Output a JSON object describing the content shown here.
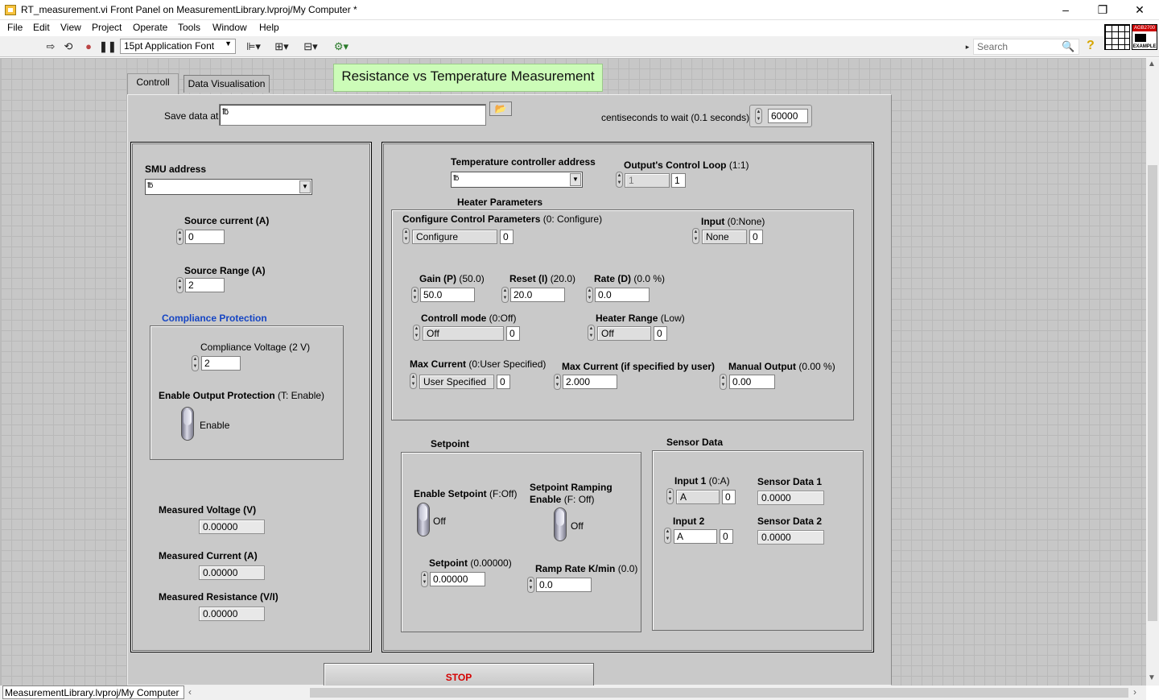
{
  "window": {
    "title": "RT_measurement.vi Front Panel on MeasurementLibrary.lvproj/My Computer *",
    "controls": [
      "–",
      "❐",
      "✕"
    ]
  },
  "menu": [
    "File",
    "Edit",
    "View",
    "Project",
    "Operate",
    "Tools",
    "Window",
    "Help"
  ],
  "toolbar": {
    "font": "15pt Application Font",
    "search_placeholder": "Search",
    "help": "?",
    "icon_top": "AGB2700",
    "icon_bottom": "EXAMPLE"
  },
  "banner": "Resistance vs Temperature Measurement",
  "tabs": [
    {
      "label": "Controll",
      "active": true
    },
    {
      "label": "Data Visualisation",
      "active": false
    }
  ],
  "save": {
    "label": "Save data at",
    "path_prefix": "℔",
    "value": ""
  },
  "wait": {
    "label": "centiseconds to wait (0.1 seconds)",
    "value": "60000"
  },
  "smu": {
    "address_label": "SMU address",
    "visa_prefix": "℔",
    "address_value": "",
    "source_current_label": "Source current (A)",
    "source_current_value": "0",
    "source_range_label": "Source Range (A)",
    "source_range_value": "2",
    "compliance_title": "Compliance Protection",
    "compliance_voltage_label": "Compliance Voltage (2 V)",
    "compliance_voltage_value": "2",
    "enable_output_label": "Enable Output Protection",
    "enable_output_hint": "(T: Enable)",
    "enable_output_state": "Enable",
    "measured_voltage_label": "Measured Voltage (V)",
    "measured_voltage_value": "0.00000",
    "measured_current_label": "Measured Current (A)",
    "measured_current_value": "0.00000",
    "measured_resistance_label": "Measured Resistance (V/I)",
    "measured_resistance_value": "0.00000"
  },
  "tc": {
    "address_label": "Temperature controller address",
    "visa_prefix": "℔",
    "address_value": "",
    "loop_label": "Output's Control Loop",
    "loop_hint": "(1:1)",
    "loop_value": "1",
    "loop_index": "1",
    "heater_title": "Heater Parameters",
    "config_label": "Configure Control Parameters",
    "config_hint": "(0: Configure)",
    "config_value": "Configure",
    "config_index": "0",
    "input_label": "Input",
    "input_hint": "(0:None)",
    "input_value": "None",
    "input_index": "0",
    "gain_label": "Gain (P)",
    "gain_hint": "(50.0)",
    "gain_value": "50.0",
    "reset_label": "Reset (I)",
    "reset_hint": "(20.0)",
    "reset_value": "20.0",
    "rate_label": "Rate (D)",
    "rate_hint": "(0.0 %)",
    "rate_value": "0.0",
    "mode_label": "Controll mode",
    "mode_hint": "(0:Off)",
    "mode_value": "Off",
    "mode_index": "0",
    "heater_range_label": "Heater Range",
    "heater_range_hint": "(Low)",
    "heater_range_value": "Off",
    "heater_range_index": "0",
    "max_current_label": "Max Current",
    "max_current_hint": "(0:User Specified)",
    "max_current_value": "User Specified",
    "max_current_index": "0",
    "max_current_user_label": "Max Current (if specified by user)",
    "max_current_user_value": "2.000",
    "manual_output_label": "Manual Output",
    "manual_output_hint": "(0.00 %)",
    "manual_output_value": "0.00"
  },
  "setpoint": {
    "title": "Setpoint",
    "enable_label": "Enable Setpoint",
    "enable_hint": "(F:Off)",
    "enable_state": "Off",
    "ramping_label": "Setpoint Ramping",
    "ramping_label2": "Enable",
    "ramping_hint": "(F: Off)",
    "ramping_state": "Off",
    "setpoint_label": "Setpoint",
    "setpoint_hint": "(0.00000)",
    "setpoint_value": "0.00000",
    "ramp_rate_label": "Ramp Rate K/min",
    "ramp_rate_hint": "(0.0)",
    "ramp_rate_value": "0.0"
  },
  "sensor": {
    "title": "Sensor Data",
    "input1_label": "Input 1",
    "input1_hint": "(0:A)",
    "input1_value": "A",
    "input1_index": "0",
    "data1_label": "Sensor Data 1",
    "data1_value": "0.0000",
    "input2_label": "Input 2",
    "input2_value": "A",
    "input2_index": "0",
    "data2_label": "Sensor Data 2",
    "data2_value": "0.0000"
  },
  "stop_label": "STOP",
  "status_path": "MeasurementLibrary.lvproj/My Computer"
}
